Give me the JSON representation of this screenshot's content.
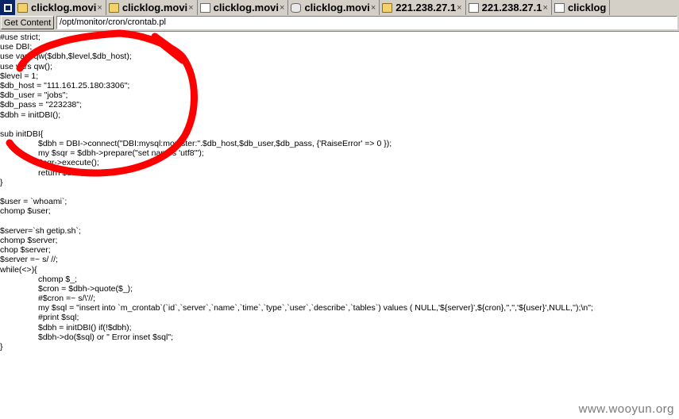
{
  "tabs": [
    {
      "label": "clicklog.movi",
      "icon": "folder-icon",
      "close": "×"
    },
    {
      "label": "clicklog.movi",
      "icon": "folder-icon",
      "close": "×"
    },
    {
      "label": "clicklog.movi",
      "icon": "page-icon",
      "close": "×"
    },
    {
      "label": "clicklog.movi",
      "icon": "database-icon",
      "close": "×"
    },
    {
      "label": "221.238.27.1",
      "icon": "folder-icon",
      "close": "×"
    },
    {
      "label": "221.238.27.1",
      "icon": "page-icon",
      "close": "×"
    },
    {
      "label": "clicklog",
      "icon": "page-icon",
      "close": ""
    }
  ],
  "toolbar": {
    "get_content_label": "Get Content",
    "path_value": "/opt/monitor/cron/crontab.pl"
  },
  "code_lines": [
    "#use strict;",
    "use DBI;",
    "use vars qw($dbh,$level,$db_host);",
    "use vars qw();",
    "$level = 1;",
    "$db_host = \"111.161.25.180:3306\";",
    "$db_user = \"jobs\";",
    "$db_pass = \"223238\";",
    "$dbh = initDBI();",
    "",
    "sub initDBI{",
    "\t$dbh = DBI->connect(\"DBI:mysql:monister:\".$db_host,$db_user,$db_pass, {'RaiseError' => 0 });",
    "\tmy $sqr = $dbh->prepare(\"set names 'utf8'\");",
    "\t$sqr->execute();",
    "\treturn $dbh;",
    "}",
    "",
    "$user = `whoami`;",
    "chomp $user;",
    "",
    "$server=`sh getip.sh`;",
    "chomp $server;",
    "chop $server;",
    "$server =~ s/ //;",
    "while(<>){",
    "\tchomp $_;",
    "\t$cron = $dbh->quote($_);",
    "\t#$cron =~ s/\\'//;",
    "\tmy $sql = \"insert into `m_crontab`(`id`,`server`,`name`,`time`,`type`,`user`,`describe`,`tables`) values ( NULL,'${server}',${cron},'','','${user}',NULL,'');\\n\";",
    "\t#print $sql;",
    "\t$dbh = initDBI() if(!$dbh);",
    "\t$dbh->do($sql) or \" Error inset $sql\";",
    "}"
  ],
  "annotation": {
    "color": "#ff0000"
  },
  "watermark": "www.wooyun.org"
}
